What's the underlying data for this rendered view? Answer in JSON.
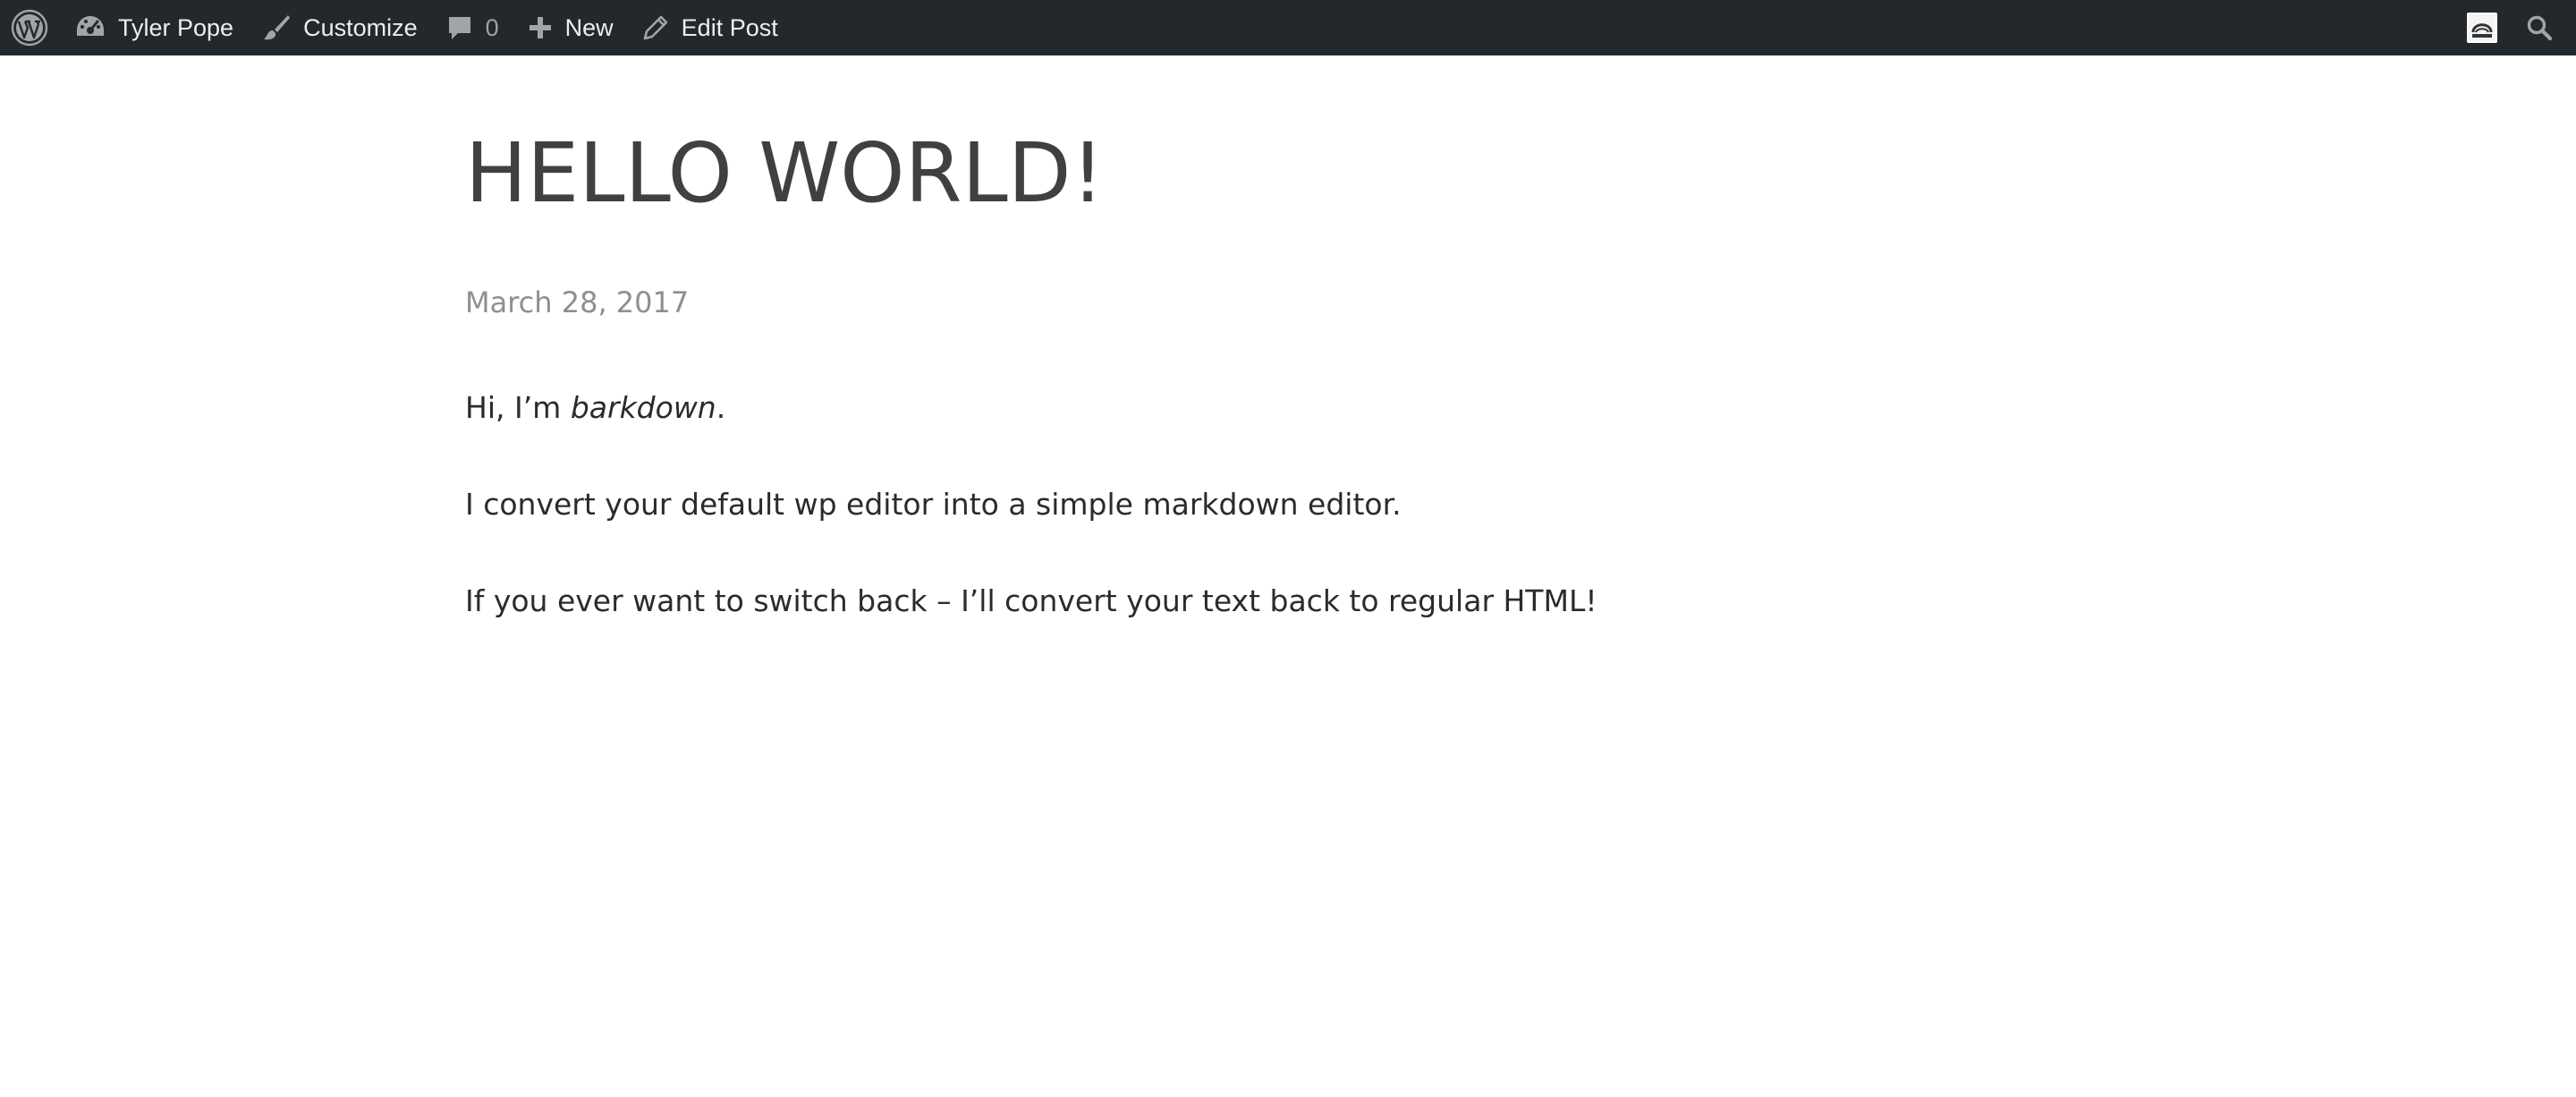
{
  "admin_bar": {
    "site_name": "Tyler Pope",
    "customize_label": "Customize",
    "comments_count": "0",
    "new_label": "New",
    "edit_post_label": "Edit Post",
    "background_color": "#23282d",
    "icons": {
      "logo": "wordpress-logo-icon",
      "site": "dashboard-icon",
      "customize": "paintbrush-icon",
      "comments": "comment-bubble-icon",
      "new": "plus-icon",
      "edit": "pencil-icon",
      "account": "avatar-icon",
      "search": "search-icon"
    }
  },
  "post": {
    "title": "HELLO WORLD!",
    "date": "March 28, 2017",
    "content": {
      "p1_prefix": "Hi, I’m ",
      "p1_emphasis": "barkdown",
      "p1_suffix": ".",
      "p2": "I convert your default wp editor into a simple markdown editor.",
      "p3": "If you ever want to switch back – I’ll convert your text back to regular HTML!"
    }
  }
}
